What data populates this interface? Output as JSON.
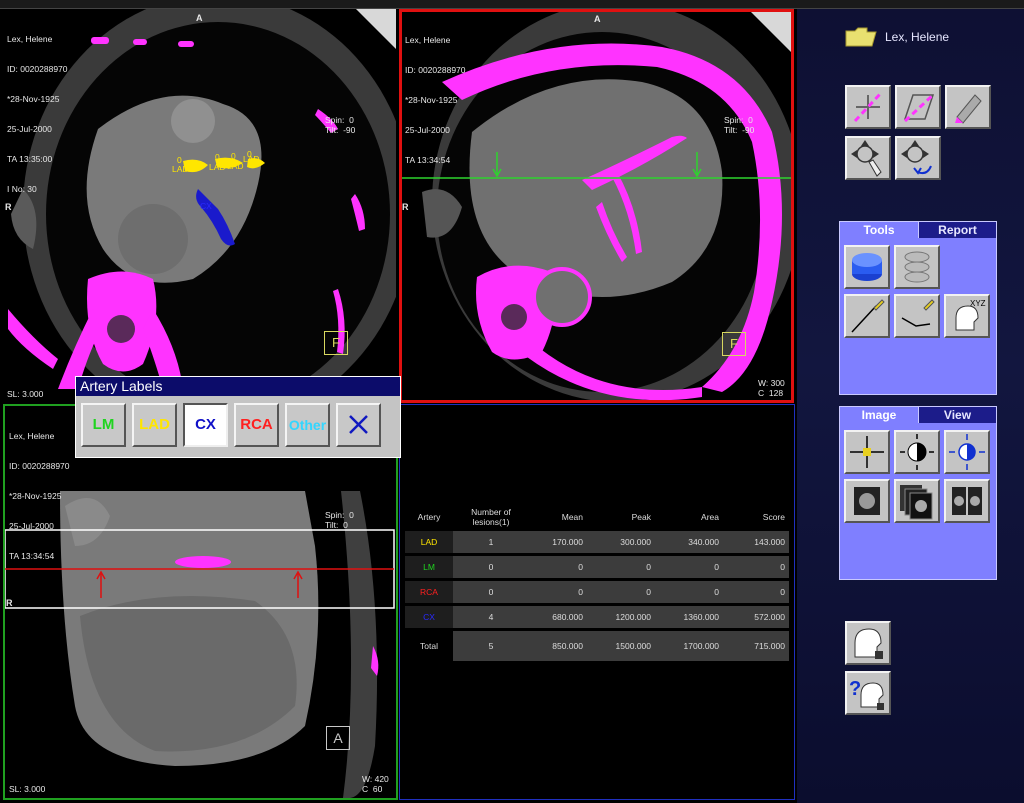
{
  "viewports": {
    "top_left": {
      "info": [
        "Lex, Helene",
        "ID: 0020288970",
        "*28-Nov-1925",
        "25-Jul-2000",
        "TA 13:35:00",
        "I No: 30"
      ],
      "orient_top": "A",
      "orient_left": "R",
      "bottom_left": "SL: 3.000",
      "region_marker": "F",
      "lesion_labels": [
        "0",
        "LAD",
        "0",
        "LAD",
        "0",
        "LAD",
        "0",
        "LAD",
        "CX"
      ],
      "spin": "Spin:  0",
      "tilt": "Tilt:  -90"
    },
    "top_right": {
      "info": [
        "Lex, Helene",
        "ID: 0020288970",
        "*28-Nov-1925",
        "25-Jul-2000",
        "TA 13:34:54"
      ],
      "orient_top": "A",
      "orient_left": "R",
      "spin": "Spin:  0",
      "tilt": "Tilt:  -90",
      "region_marker": "F",
      "window": "W: 300",
      "center": "C  128"
    },
    "bottom_left": {
      "info": [
        "Lex, Helene",
        "ID: 0020288970",
        "*28-Nov-1925",
        "25-Jul-2000",
        "TA 13:34:54"
      ],
      "spin": "Spin:  0",
      "tilt": "Tilt:  0",
      "orient_left": "R",
      "region_marker": "A",
      "bottom_left": "SL: 3.000",
      "window": "W: 420",
      "center": "C  60"
    }
  },
  "artery_dialog": {
    "title": "Artery Labels",
    "buttons": [
      {
        "label": "LM",
        "color": "#1fd41f"
      },
      {
        "label": "LAD",
        "color": "#ffe600"
      },
      {
        "label": "CX",
        "color": "#1010c8",
        "selected": true
      },
      {
        "label": "RCA",
        "color": "#ff2020"
      },
      {
        "label": "Other",
        "color": "#33d6ff"
      }
    ],
    "close_icon": "close-x-icon"
  },
  "score_table": {
    "headers": [
      "Artery",
      "Number of\nlesions(1)",
      "Mean",
      "Peak",
      "Area",
      "Score"
    ],
    "rows": [
      {
        "artery": "LAD",
        "color": "#ffe600",
        "lesions": "1",
        "mean": "170.000",
        "peak": "300.000",
        "area": "340.000",
        "score": "143.000"
      },
      {
        "artery": "LM",
        "color": "#1fd41f",
        "lesions": "0",
        "mean": "0",
        "peak": "0",
        "area": "0",
        "score": "0"
      },
      {
        "artery": "RCA",
        "color": "#ff2020",
        "lesions": "0",
        "mean": "0",
        "peak": "0",
        "area": "0",
        "score": "0"
      },
      {
        "artery": "CX",
        "color": "#2a2aff",
        "lesions": "4",
        "mean": "680.000",
        "peak": "1200.000",
        "area": "1360.000",
        "score": "572.000"
      }
    ],
    "total": {
      "artery": "Total",
      "lesions": "5",
      "mean": "850.000",
      "peak": "1500.000",
      "area": "1700.000",
      "score": "715.000"
    }
  },
  "side_panel": {
    "patient_name": "Lex, Helene",
    "folder_icon": "folder-icon",
    "tools_panel": {
      "tabs": [
        "Tools",
        "Report"
      ],
      "active": "Tools"
    },
    "image_panel": {
      "tabs": [
        "Image",
        "View"
      ],
      "active": "Image"
    },
    "xyz_label": "XYZ",
    "help_label": "?"
  },
  "colors": {
    "calcium": "#ff33ff",
    "active_frame": "#e01010",
    "sagittal_frame": "#20a020",
    "table_frame": "#2030c0",
    "panel": "#7f7fff"
  }
}
